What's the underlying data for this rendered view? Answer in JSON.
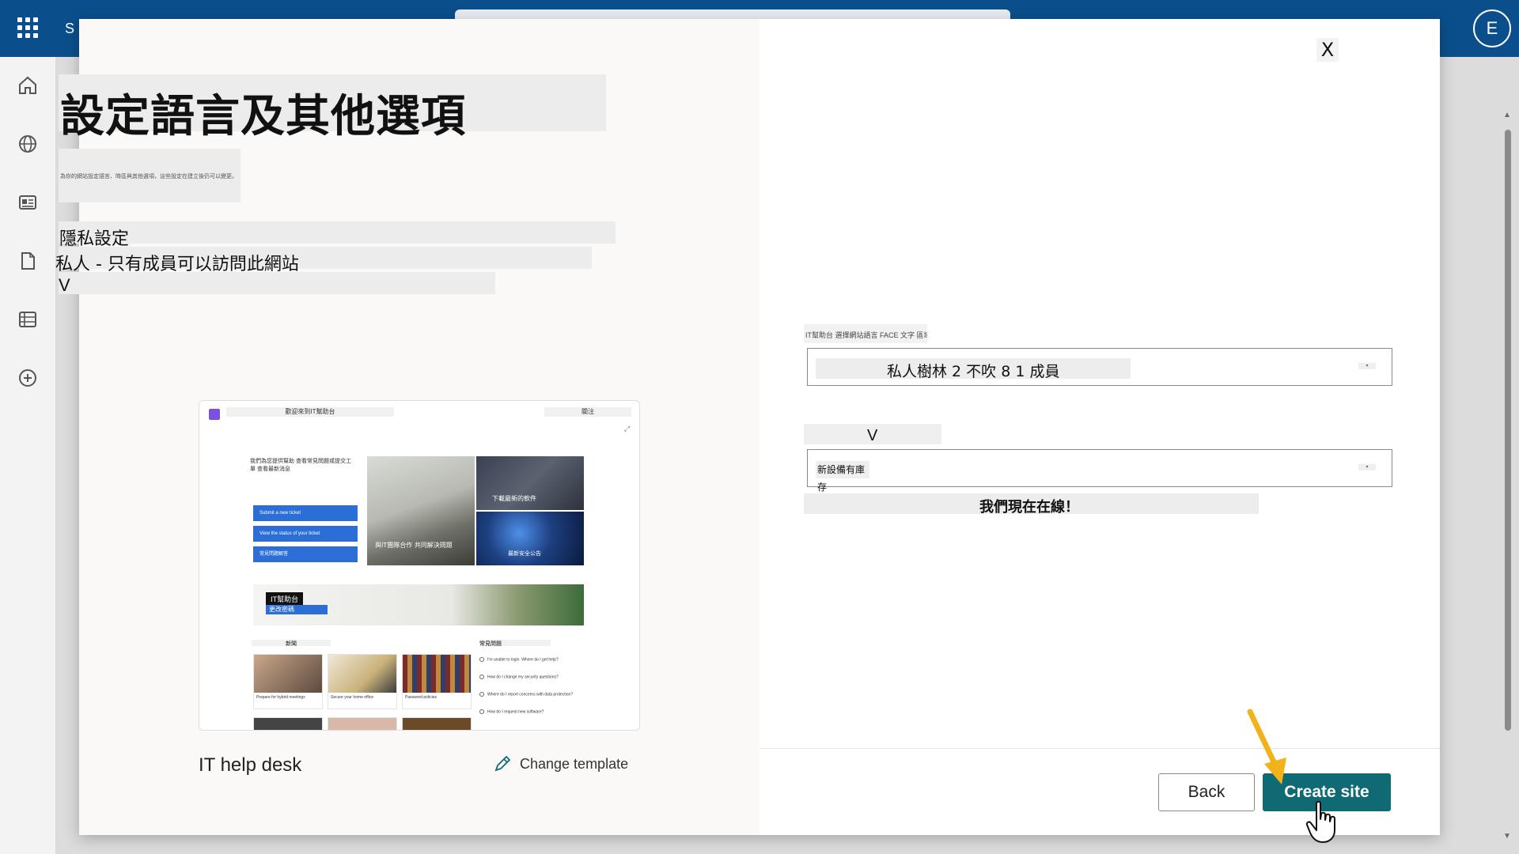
{
  "app": {
    "brand_initial": "S",
    "user_initial": "E"
  },
  "dialog": {
    "title": "設定語言及其他選項",
    "description": "為你的網站設定語言、時區與其他選項，這些設定在建立後仍可以變更。",
    "privacy_label": "隱私設定",
    "privacy_value": "私人 - 只有成員可以訪問此網站",
    "privacy_chevron": "V",
    "template_preview": {
      "site_name": "歡迎來到IT幫助台",
      "follow": "關注",
      "intro": "我們為您提供幫助 查看常見問題或提交工單 查看最新消息",
      "buttons": [
        "Submit a new ticket",
        "View the status of your ticket",
        "常見問題解答"
      ],
      "banner_title": "IT幫助台",
      "banner_button": "更改密碼",
      "tile_captions": [
        "下載最新的軟件",
        "與IT團隊合作 共同解決問題",
        "最新安全公告"
      ],
      "section_news": "新聞",
      "section_faq": "常見問題",
      "cards": [
        "Prepare for hybrid meetings",
        "Secure your home office",
        "Password policies"
      ],
      "faqs": [
        "I'm unable to login. Where do I get help?",
        "How do I change my security questions?",
        "Where do I report concerns with data protection?",
        "How do I request new software?"
      ]
    },
    "template_name": "IT help desk",
    "change_template": "Change template",
    "close_label": "X",
    "language_label": "IT幫助台 選擇網站語言 FACE 文字 區域設定",
    "language_value": "私人樹林 2 不吹 8 1 成員",
    "language_chevron": "▾",
    "timezone_label": "V",
    "timezone_value": "新設備有庫存",
    "timezone_chevron": "▾",
    "status_text": "我們現在在線！",
    "back_label": "Back",
    "create_label": "Create site"
  },
  "colors": {
    "topbar": "#0a4f8c",
    "primary_button": "#0f6a73",
    "arrow": "#f2b21c"
  },
  "icons": [
    "app-launcher-icon",
    "home-icon",
    "globe-icon",
    "news-icon",
    "document-icon",
    "list-icon",
    "add-icon",
    "pencil-icon",
    "close-icon",
    "arrow-pointer-icon",
    "hand-cursor-icon"
  ]
}
